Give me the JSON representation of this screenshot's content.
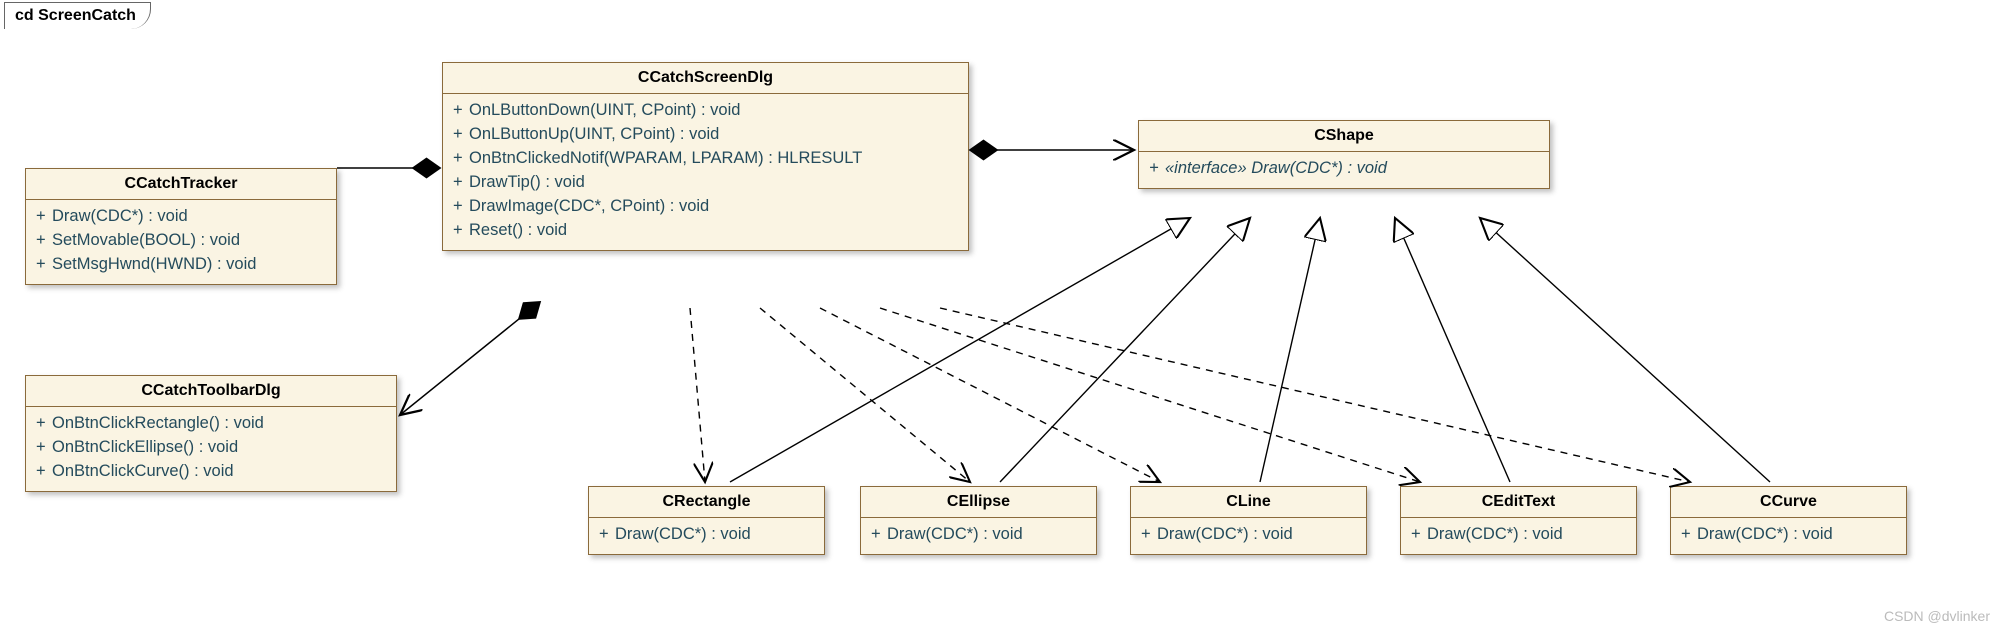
{
  "diagram": {
    "title": "cd ScreenCatch",
    "watermark": "CSDN @dvlinker"
  },
  "classes": {
    "tracker": {
      "name": "CCatchTracker",
      "m": [
        "Draw(CDC*) : void",
        "SetMovable(BOOL) : void",
        "SetMsgHwnd(HWND) : void"
      ]
    },
    "dlg": {
      "name": "CCatchScreenDlg",
      "m": [
        "OnLButtonDown(UINT, CPoint) : void",
        "OnLButtonUp(UINT, CPoint) : void",
        "OnBtnClickedNotif(WPARAM, LPARAM) : HLRESULT",
        "DrawTip() : void",
        "DrawImage(CDC*, CPoint) : void",
        "Reset() : void"
      ]
    },
    "toolbar": {
      "name": "CCatchToolbarDlg",
      "m": [
        "OnBtnClickRectangle() : void",
        "OnBtnClickEllipse() : void",
        "OnBtnClickCurve() : void"
      ]
    },
    "shape": {
      "name": "CShape",
      "m_interface": "«interface» Draw(CDC*) : void"
    },
    "rect": {
      "name": "CRectangle",
      "m": "Draw(CDC*) : void"
    },
    "ell": {
      "name": "CEllipse",
      "m": "Draw(CDC*) : void"
    },
    "line": {
      "name": "CLine",
      "m": "Draw(CDC*) : void"
    },
    "text": {
      "name": "CEditText",
      "m": "Draw(CDC*) : void"
    },
    "curve": {
      "name": "CCurve",
      "m": "Draw(CDC*) : void"
    }
  },
  "relations": [
    {
      "from": "CCatchScreenDlg",
      "to": "CCatchTracker",
      "type": "composition"
    },
    {
      "from": "CCatchScreenDlg",
      "to": "CShape",
      "type": "composition"
    },
    {
      "from": "CCatchScreenDlg",
      "to": "CCatchToolbarDlg",
      "type": "composition-arrow"
    },
    {
      "from": "CCatchScreenDlg",
      "to": "CRectangle",
      "type": "dependency"
    },
    {
      "from": "CCatchScreenDlg",
      "to": "CEllipse",
      "type": "dependency"
    },
    {
      "from": "CCatchScreenDlg",
      "to": "CLine",
      "type": "dependency"
    },
    {
      "from": "CCatchScreenDlg",
      "to": "CEditText",
      "type": "dependency"
    },
    {
      "from": "CCatchScreenDlg",
      "to": "CCurve",
      "type": "dependency"
    },
    {
      "from": "CRectangle",
      "to": "CShape",
      "type": "realization"
    },
    {
      "from": "CEllipse",
      "to": "CShape",
      "type": "realization"
    },
    {
      "from": "CLine",
      "to": "CShape",
      "type": "realization"
    },
    {
      "from": "CEditText",
      "to": "CShape",
      "type": "realization"
    },
    {
      "from": "CCurve",
      "to": "CShape",
      "type": "realization"
    }
  ]
}
